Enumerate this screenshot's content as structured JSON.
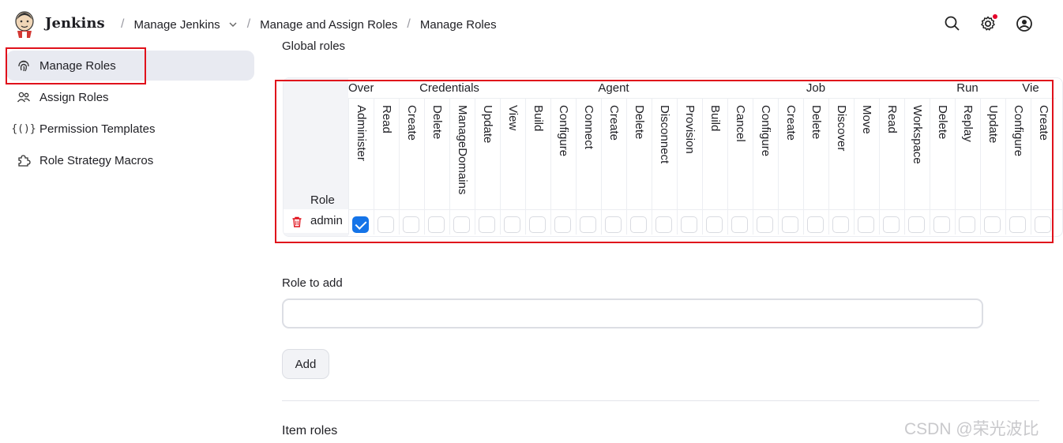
{
  "header": {
    "brand": "Jenkins",
    "breadcrumbs": [
      "Manage Jenkins",
      "Manage and Assign Roles",
      "Manage Roles"
    ],
    "icons": [
      "search-icon",
      "settings-icon",
      "user-icon"
    ]
  },
  "sidebar": {
    "items": [
      {
        "label": "Manage Roles",
        "icon": "fingerprint-icon",
        "active": true
      },
      {
        "label": "Assign Roles",
        "icon": "people-icon",
        "active": false
      },
      {
        "label": "Permission Templates",
        "icon": "braces-icon",
        "active": false
      },
      {
        "label": "Role Strategy Macros",
        "icon": "puzzle-icon",
        "active": false
      }
    ]
  },
  "global_roles": {
    "title": "Global roles",
    "role_header": "Role",
    "groups": [
      "Overall",
      "Credentials",
      "Agent",
      "Job",
      "Run",
      "Vie"
    ],
    "permissions": [
      "Administer",
      "Read",
      "Create",
      "Delete",
      "ManageDomains",
      "Update",
      "View",
      "Build",
      "Configure",
      "Connect",
      "Create",
      "Delete",
      "Disconnect",
      "Provision",
      "Build",
      "Cancel",
      "Configure",
      "Create",
      "Delete",
      "Discover",
      "Move",
      "Read",
      "Workspace",
      "Delete",
      "Replay",
      "Update",
      "Configure",
      "Create"
    ],
    "rows": [
      {
        "role": "admin",
        "checked": [
          true,
          false,
          false,
          false,
          false,
          false,
          false,
          false,
          false,
          false,
          false,
          false,
          false,
          false,
          false,
          false,
          false,
          false,
          false,
          false,
          false,
          false,
          false,
          false,
          false,
          false,
          false,
          false
        ]
      }
    ]
  },
  "role_to_add": {
    "label": "Role to add",
    "value": "",
    "button": "Add"
  },
  "item_roles_title": "Item roles",
  "watermark": "CSDN @荣光波比",
  "colors": {
    "highlight_box": "#e0111b",
    "checkbox_checked": "#1574e8",
    "active_bg": "#e8eaf1"
  }
}
